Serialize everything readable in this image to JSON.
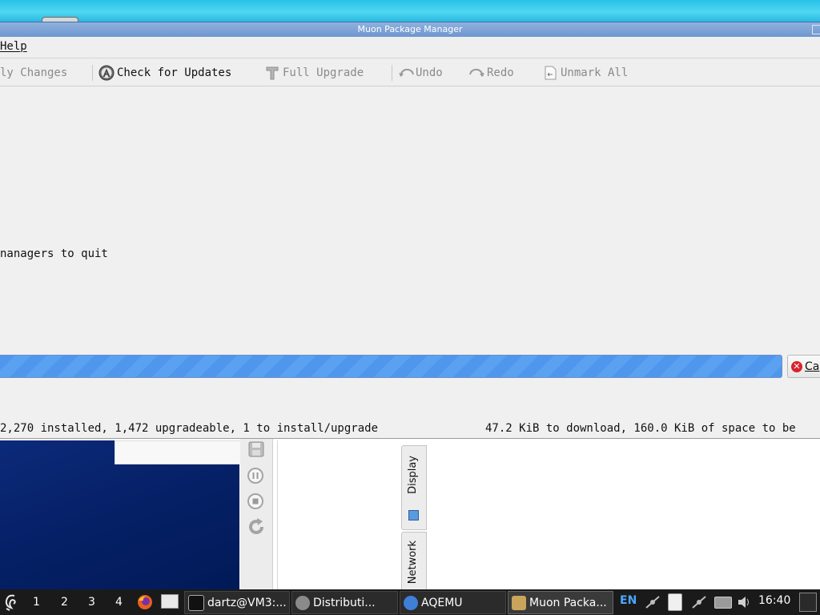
{
  "window": {
    "title": "Muon Package Manager"
  },
  "menubar": {
    "help_label": "Help"
  },
  "toolbar": {
    "apply_changes": "ly Changes",
    "check_updates": "Check for Updates",
    "full_upgrade": "Full Upgrade",
    "undo": "Undo",
    "redo": "Redo",
    "unmark_all": "Unmark All"
  },
  "main": {
    "message": "nanagers to quit"
  },
  "progress": {
    "cancel_label": "Ca"
  },
  "status": {
    "left": "2,270 installed, 1,472 upgradeable, 1 to install/upgrade",
    "right": "47.2 KiB to download, 160.0 KiB of space to be"
  },
  "aqemu": {
    "tabs": [
      "Display",
      "Network"
    ]
  },
  "taskbar": {
    "workspaces": [
      "1",
      "2",
      "3",
      "4"
    ],
    "tasks": [
      {
        "label": "dartz@VM3:..."
      },
      {
        "label": "Distributi..."
      },
      {
        "label": "AQEMU"
      },
      {
        "label": "Muon Packa..."
      }
    ],
    "language": "EN",
    "clock": "16:40"
  },
  "colors": {
    "titlebar": "#7aa0d6",
    "progress": "#4f97ec",
    "taskbar": "#1a1a1a",
    "vm_screen": "#062066"
  }
}
